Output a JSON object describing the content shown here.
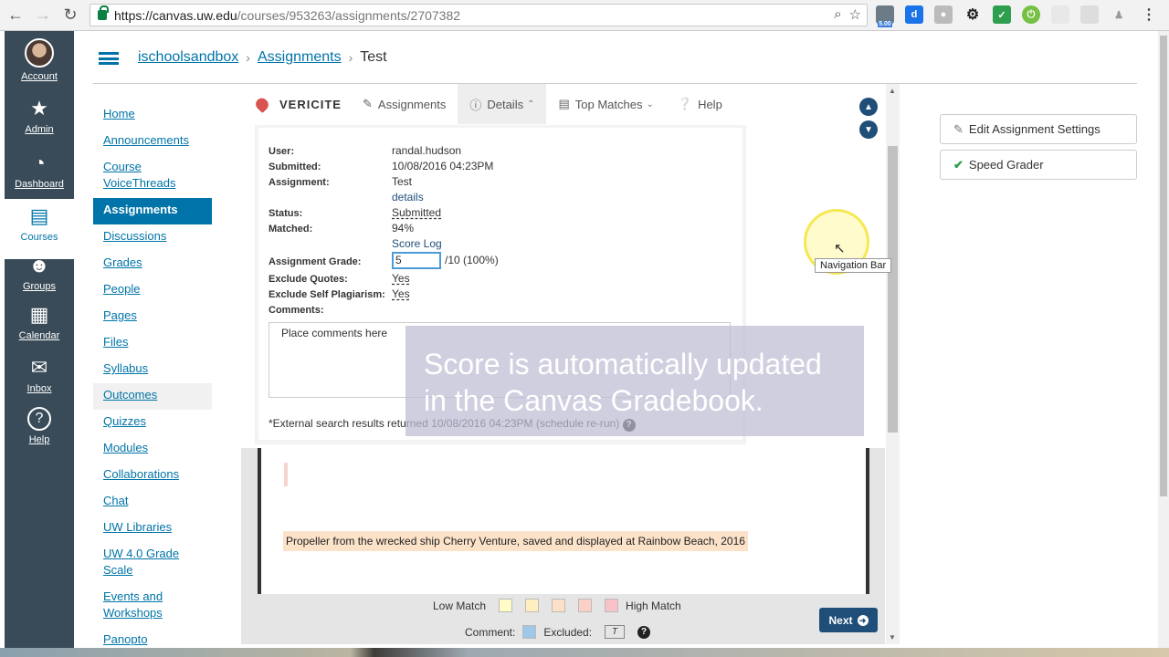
{
  "browser": {
    "url_host": "https://canvas.uw.edu",
    "url_path": "/courses/953263/assignments/2707382",
    "ext_badge": "5.00"
  },
  "global_nav": {
    "items": [
      {
        "label": "Account",
        "icon": "user-avatar"
      },
      {
        "label": "Admin",
        "icon": "shield-icon"
      },
      {
        "label": "Dashboard",
        "icon": "gauge-icon"
      },
      {
        "label": "Courses",
        "icon": "book-icon"
      },
      {
        "label": "Groups",
        "icon": "people-icon"
      },
      {
        "label": "Calendar",
        "icon": "calendar-icon"
      },
      {
        "label": "Inbox",
        "icon": "inbox-icon"
      },
      {
        "label": "Help",
        "icon": "question-icon"
      }
    ]
  },
  "breadcrumb": {
    "course": "ischoolsandbox",
    "section": "Assignments",
    "current": "Test"
  },
  "course_nav": [
    "Home",
    "Announcements",
    "Course VoiceThreads",
    "Assignments",
    "Discussions",
    "Grades",
    "People",
    "Pages",
    "Files",
    "Syllabus",
    "Outcomes",
    "Quizzes",
    "Modules",
    "Collaborations",
    "Chat",
    "UW Libraries",
    "UW 4.0 Grade Scale",
    "Events and Workshops",
    "Panopto"
  ],
  "vericite": {
    "logo": "VERICITE",
    "tabs": {
      "assignments": "Assignments",
      "details": "Details",
      "top_matches": "Top Matches",
      "help": "Help"
    },
    "labels": {
      "user": "User:",
      "submitted": "Submitted:",
      "assignment": "Assignment:",
      "status": "Status:",
      "matched": "Matched:",
      "grade": "Assignment Grade:",
      "exclude_quotes": "Exclude Quotes:",
      "exclude_self": "Exclude Self Plagiarism:",
      "comments": "Comments:"
    },
    "values": {
      "user": "randal.hudson",
      "submitted": "10/08/2016 04:23PM",
      "assignment": "Test",
      "details_link": "details",
      "status": "Submitted",
      "matched": "94%",
      "score_log": "Score Log",
      "grade": "5",
      "grade_suffix": "/10 (100%)",
      "exclude_quotes": "Yes",
      "exclude_self": "Yes",
      "comments_placeholder": "Place comments here"
    },
    "external_note": "*External search results returned 10/08/2016 04:23PM (schedule re-run)",
    "doc_caption": "Propeller from the wrecked ship Cherry Venture, saved and displayed at Rainbow Beach, 2016",
    "legend": {
      "low": "Low Match",
      "high": "High Match",
      "comment": "Comment:",
      "excluded": "Excluded:",
      "excluded_sample": "T"
    },
    "swatch_colors": [
      "#fffcc7",
      "#ffeec0",
      "#fde0c8",
      "#fbd1c7",
      "#f8c2c8"
    ],
    "comment_color": "#9dc8e6",
    "next": "Next"
  },
  "overlay_text": "Score is automatically updated in the Canvas Gradebook.",
  "sidebar_buttons": {
    "edit": "Edit Assignment Settings",
    "speed": "Speed Grader"
  },
  "tooltip": "Navigation Bar"
}
